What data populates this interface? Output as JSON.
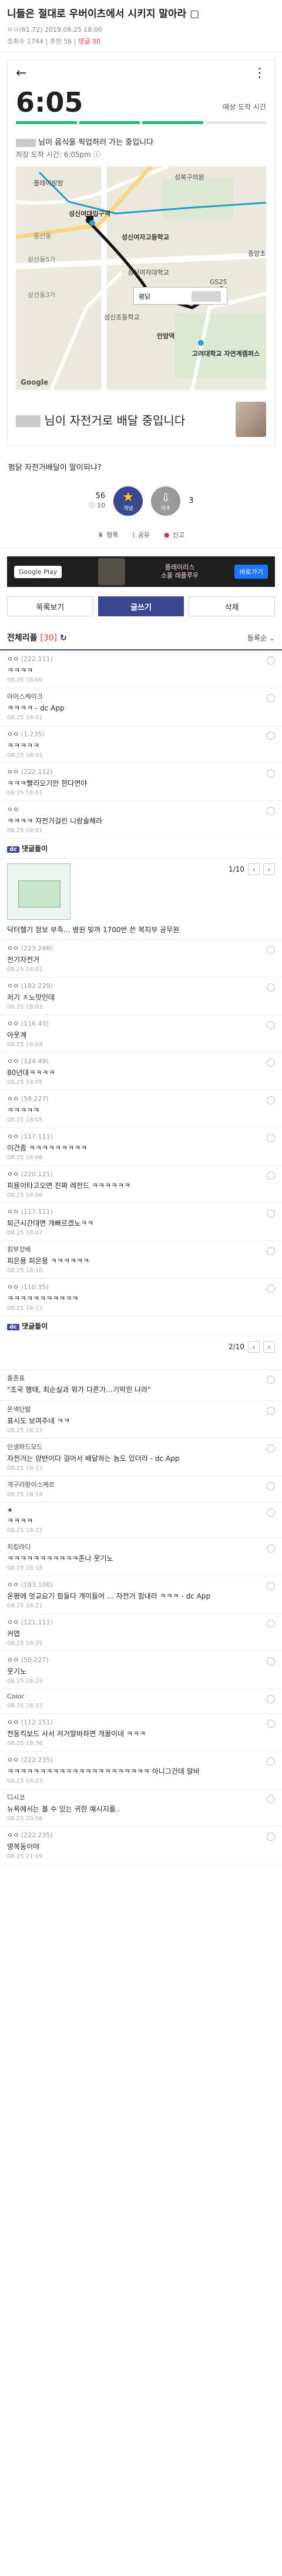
{
  "post": {
    "title": "니들은 절대로 우버이츠에서 시키지 말아라 ▢",
    "author": "ㅇㅇ(61.72)",
    "date": "2019.08.25 18:00",
    "views": "조회수 1744",
    "recommend": "추천 56",
    "comments_label": "댓글 30"
  },
  "shot": {
    "back": "←",
    "menu": "⋮",
    "eta_time": "6:05",
    "eta_label": "예상 도착 시간",
    "order_line": "님이 음식을 픽업하러 가는 중입니다",
    "arrival_line": "최장 도착 시간: 6:05pm ⓘ",
    "rider_line": "님이 자전거로 배달 중입니다",
    "map_labels": [
      "플레이빙밤",
      "성북구의원",
      "성신여대입구역",
      "성신여자고등학교",
      "동선동",
      "성신여자대학교",
      "종암초",
      "삼선동5가",
      "GS25",
      "성신초등학교",
      "안암역",
      "고려대학교 자연계캠퍼스",
      "삼선동3가",
      "Google"
    ],
    "popup_label": "평닭"
  },
  "body": {
    "text": "펌닭 자전거배달이 말이되냐?"
  },
  "votes": {
    "up_count": "56",
    "up_fixed": "ⓘ 10",
    "up_label": "개념",
    "down_label": "비추",
    "down_count": "3"
  },
  "actions": {
    "bookmark": "헝목",
    "share": "공유",
    "report": "신고"
  },
  "ad": {
    "store": "Google Play",
    "copy1": "플레이리스",
    "copy2": "소울 레플루우",
    "cta": "바로가기"
  },
  "buttons": {
    "list": "목록보기",
    "write": "글쓰기",
    "delete": "삭제"
  },
  "comments_header": {
    "label": "전체리플",
    "count": "[30]",
    "sort": "등록순 ⌄"
  },
  "comments": [
    {
      "nick": "ㅇㅇ",
      "ip": "(222.111)",
      "text": "ㅋㅋㅋㅋ",
      "date": "08.25 18:00"
    },
    {
      "nick": "아이스케이크",
      "ip": "",
      "text": "ㅋㅋㅋㅋ - dc App",
      "date": "08.25 18:01"
    },
    {
      "nick": "ㅇㅇ",
      "ip": "(1.235)",
      "text": "ㅋㅋㅋㅋㅋ",
      "date": "08.25 18:01"
    },
    {
      "nick": "ㅇㅇ",
      "ip": "(222.112)",
      "text": "ㅋㅋㅋ빨리오기만 한다면야",
      "date": "08.25 18:01"
    },
    {
      "nick": "ㅇㅇ",
      "ip": "",
      "text": "ㅋㅋㅋㅋ 자전거걸린 니랑술해라",
      "date": "08.25 18:01"
    }
  ],
  "dccon1": {
    "label": "댓글돌이",
    "pager": "1/10",
    "title": "닥터헬기 정보 부족... 병원 빚까 1700번 쓴 복지부 공무원"
  },
  "comments2": [
    {
      "nick": "ㅇㅇ",
      "ip": "(223.246)",
      "text": "전기자전거",
      "date": "08.25 18:01"
    },
    {
      "nick": "ㅇㅇ",
      "ip": "(182.229)",
      "text": "저기 ㅈ노맛인데",
      "date": "08.25 18:03"
    },
    {
      "nick": "ㅇㅇ",
      "ip": "(116.43)",
      "text": "아웃계",
      "date": "08.25 18:04"
    },
    {
      "nick": "ㅇㅇ",
      "ip": "(124.49)",
      "text": "80년대ㅋㅋㅋㅋ",
      "date": "08.25 18:05"
    },
    {
      "nick": "ㅇㅇ",
      "ip": "(58.227)",
      "text": "ㅋㅋㅋㅋㅋ",
      "date": "08.25 18:05"
    },
    {
      "nick": "ㅇㅇ",
      "ip": "(117.111)",
      "text": "이건좀 ㅋㅋㅋㅋㅋㅋㅋㅋㅋ",
      "date": "08.25 18:06"
    },
    {
      "nick": "ㅇㅇ",
      "ip": "(220.121)",
      "text": "피용이타고오면 진짜 레전드 ㅋㅋㅋㅋㅋㅋ",
      "date": "08.25 18:06"
    },
    {
      "nick": "ㅇㅇ",
      "ip": "(117.111)",
      "text": "퇴근시간대면 개빠르겠노ㅋㅋ",
      "date": "08.25 18:07"
    },
    {
      "nick": "킹부갓배",
      "ip": "",
      "text": "피은용 피은용 ㅋㅋㅋㅋㅋㅋ",
      "date": "08.25 18:10"
    },
    {
      "nick": "ㅇㅇ",
      "ip": "(110.35)",
      "text": "ㅋㅋㅋㅋㅋㅋㅋㅋㅋㅋㅋ",
      "date": "08.25 18:13"
    }
  ],
  "dccon2": {
    "label": "댓글돌이",
    "pager": "2/10"
  },
  "comments3": [
    {
      "nick": "홍준표",
      "ip": "",
      "text": "\"조국 행태, 최순실과 뭐가 다른가…기막힌 나라\"",
      "date": ""
    },
    {
      "nick": "은색단발",
      "ip": "",
      "text": "표시도 보여주네 ㅋㅋ",
      "date": "08.25 18:13"
    },
    {
      "nick": "인생하드모드",
      "ip": "",
      "text": "자전거는 양반이다 걸어서 배달하는 놈도 있더라 - dc App",
      "date": "08.25 18:13"
    },
    {
      "nick": "개구리랑이스케르",
      "ip": "",
      "text": "",
      "date": "08.25 18:14"
    },
    {
      "nick": "★",
      "ip": "",
      "text": "ㅋㅋㅋㅋ",
      "date": "08.25 18:17"
    },
    {
      "nick": "치킹라디",
      "ip": "",
      "text": "ㅋㅋㅋㅋㅋㅋㅋㅋㅋㅋㅋ존나 웃기노",
      "date": "08.25 18:18"
    },
    {
      "nick": "ㅇㅇ",
      "ip": "(183.100)",
      "text": "온평에 엇교요기 힘들다 개미들어 … 자전거 힘내라 ㅋㅋㅋ - dc App",
      "date": "08.25 18:21"
    },
    {
      "nick": "ㅇㅇ",
      "ip": "(121.111)",
      "text": "커엽",
      "date": "08.25 18:25"
    },
    {
      "nick": "ㅇㅇ",
      "ip": "(58.227)",
      "text": "웃기노",
      "date": "08.25 18:29"
    },
    {
      "nick": "Color",
      "ip": "",
      "text": "",
      "date": "08.25 18:33"
    },
    {
      "nick": "ㅇㅇ",
      "ip": "(112.151)",
      "text": "전동킥보드 사서 저거알바하면 개꿀이네 ㅋㅋㅋ",
      "date": "08.25 18:36"
    },
    {
      "nick": "ㅇㅇ",
      "ip": "(222.235)",
      "text": "ㅋㅋㅋㅋㅋㅋㅋㅋㅋㅋㅋㅋㅋㅋㅋㅋㅋㅋㅋㅋㅋㅋ 아니그건데 알바",
      "date": "08.25 19:23"
    },
    {
      "nick": "디시코",
      "ip": "",
      "text": "뉴욕에서는 볼 수 있는 귀한 예시지를..",
      "date": "08.25 20:08"
    },
    {
      "nick": "ㅇㅇ",
      "ip": "(222.235)",
      "text": "영복동이야",
      "date": "08.25 21:09"
    }
  ]
}
